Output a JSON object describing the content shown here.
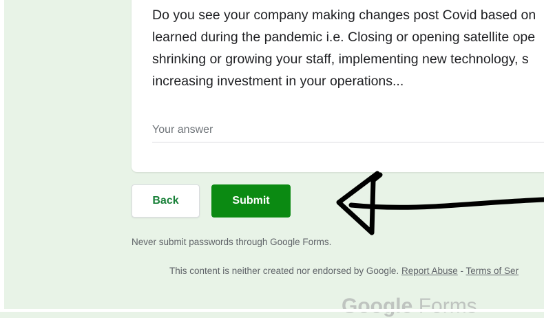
{
  "form": {
    "question_lines": [
      "Do you see your company making changes post Covid based on",
      "learned during the pandemic i.e. Closing or opening satellite ope",
      "shrinking or growing your staff, implementing new technology, s",
      "increasing investment in your operations..."
    ],
    "answer_placeholder": "Your answer"
  },
  "buttons": {
    "back_label": "Back",
    "submit_label": "Submit"
  },
  "notice": "Never submit passwords through Google Forms.",
  "footer": {
    "text": "This content is neither created nor endorsed by Google.",
    "report_abuse": "Report Abuse",
    "separator": " - ",
    "terms": "Terms of Ser"
  },
  "brand": {
    "google": "Google",
    "forms": "Forms"
  },
  "annotation": {
    "icon": "hand-drawn-arrow-icon",
    "color": "#000000"
  },
  "colors": {
    "background": "#e8f3e7",
    "accent_green": "#0b8a12",
    "back_text": "#188038"
  }
}
